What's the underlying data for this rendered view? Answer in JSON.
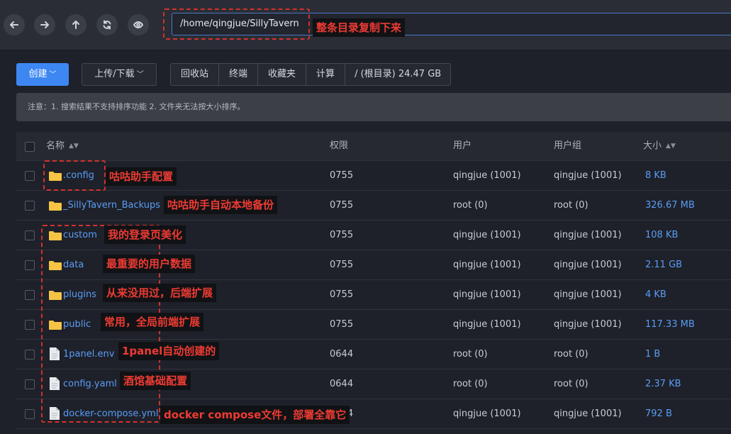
{
  "path": "/home/qingjue/SillyTavern",
  "toolbar": {
    "create": "创建",
    "upload": "上传/下载",
    "recycle": "回收站",
    "terminal": "终端",
    "favorites": "收藏夹",
    "calculate": "计算",
    "disk": "/ (根目录) 24.47 GB"
  },
  "notice": "注意：1. 搜索结果不支持排序功能 2. 文件夹无法按大小排序。",
  "columns": {
    "name": "名称",
    "perm": "权限",
    "user": "用户",
    "group": "用户组",
    "size": "大小"
  },
  "rows": [
    {
      "name": ".config",
      "perm": "0755",
      "user": "qingjue (1001)",
      "group": "qingjue (1001)",
      "size": "8 KB"
    },
    {
      "name": "_SillyTavern_Backups",
      "perm": "0755",
      "user": "root (0)",
      "group": "root (0)",
      "size": "326.67 MB"
    },
    {
      "name": "custom",
      "perm": "0755",
      "user": "qingjue (1001)",
      "group": "qingjue (1001)",
      "size": "108 KB"
    },
    {
      "name": "data",
      "perm": "0755",
      "user": "qingjue (1001)",
      "group": "qingjue (1001)",
      "size": "2.11 GB"
    },
    {
      "name": "plugins",
      "perm": "0755",
      "user": "qingjue (1001)",
      "group": "qingjue (1001)",
      "size": "4 KB"
    },
    {
      "name": "public",
      "perm": "0755",
      "user": "qingjue (1001)",
      "group": "qingjue (1001)",
      "size": "117.33 MB"
    },
    {
      "name": "1panel.env",
      "perm": "0644",
      "user": "root (0)",
      "group": "root (0)",
      "size": "1 B"
    },
    {
      "name": "config.yaml",
      "perm": "0644",
      "user": "root (0)",
      "group": "root (0)",
      "size": "2.37 KB"
    },
    {
      "name": "docker-compose.yml",
      "perm": "0644",
      "user": "qingjue (1001)",
      "group": "qingjue (1001)",
      "size": "792 B"
    }
  ],
  "annotations": {
    "path": "整条目录复制下来",
    "config": "咕咕助手配置",
    "backups": "咕咕助手自动本地备份",
    "custom": "我的登录页美化",
    "data": "最重要的用户数据",
    "plugins": "从来没用过，后端扩展",
    "public": "常用，全局前端扩展",
    "env": "1panel自动创建的",
    "yaml": "酒馆基础配置",
    "compose": "docker compose文件，部署全靠它"
  },
  "colors": {
    "accent": "#3d87f2",
    "annotation": "#ee3b33",
    "folder": "#f6c445"
  }
}
